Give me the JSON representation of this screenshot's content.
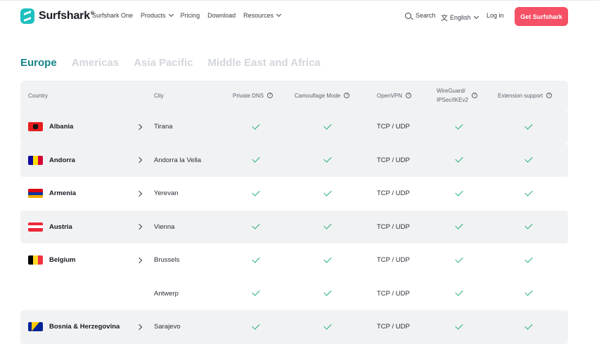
{
  "header": {
    "brand": "Surfshark",
    "brand_reg": "®",
    "nav": [
      {
        "label": "Surfshark One",
        "dropdown": false
      },
      {
        "label": "Products",
        "dropdown": true
      },
      {
        "label": "Pricing",
        "dropdown": false
      },
      {
        "label": "Download",
        "dropdown": false
      },
      {
        "label": "Resources",
        "dropdown": true
      }
    ],
    "search_label": "Search",
    "language_label": "English",
    "login_label": "Log in",
    "cta_label": "Get Surfshark"
  },
  "tabs": [
    {
      "label": "Europe",
      "active": true
    },
    {
      "label": "Americas",
      "active": false
    },
    {
      "label": "Asia Pacific",
      "active": false
    },
    {
      "label": "Middle East and Africa",
      "active": false
    }
  ],
  "table": {
    "headers": {
      "country": "Country",
      "city": "City",
      "private_dns": "Private DNS",
      "camouflage": "Camouflage Mode",
      "openvpn": "OpenVPN",
      "wireguard_line1": "WireGuard/",
      "wireguard_line2": "IPSec/IKEv2",
      "extension": "Extension support"
    },
    "rows": [
      {
        "country": "Albania",
        "flag": "albania",
        "city": "Tirana",
        "openvpn": "TCP / UDP"
      },
      {
        "country": "Andorra",
        "flag": "andorra",
        "city": "Andorra la Vella",
        "openvpn": "TCP / UDP"
      },
      {
        "country": "Armenia",
        "flag": "armenia",
        "city": "Yerevan",
        "openvpn": "TCP / UDP"
      },
      {
        "country": "Austria",
        "flag": "austria",
        "city": "Vienna",
        "openvpn": "TCP / UDP"
      },
      {
        "country": "Belgium",
        "flag": "belgium",
        "city": "Brussels",
        "openvpn": "TCP / UDP"
      },
      {
        "country": "",
        "flag": "",
        "city": "Antwerp",
        "openvpn": "TCP / UDP"
      },
      {
        "country": "Bosnia & Herzegovina",
        "flag": "bosnia",
        "city": "Sarajevo",
        "openvpn": "TCP / UDP"
      }
    ]
  },
  "colors": {
    "accent": "#16848a",
    "cta": "#f55065",
    "check": "#1fae71",
    "row_shade": "#f1f2f4"
  }
}
